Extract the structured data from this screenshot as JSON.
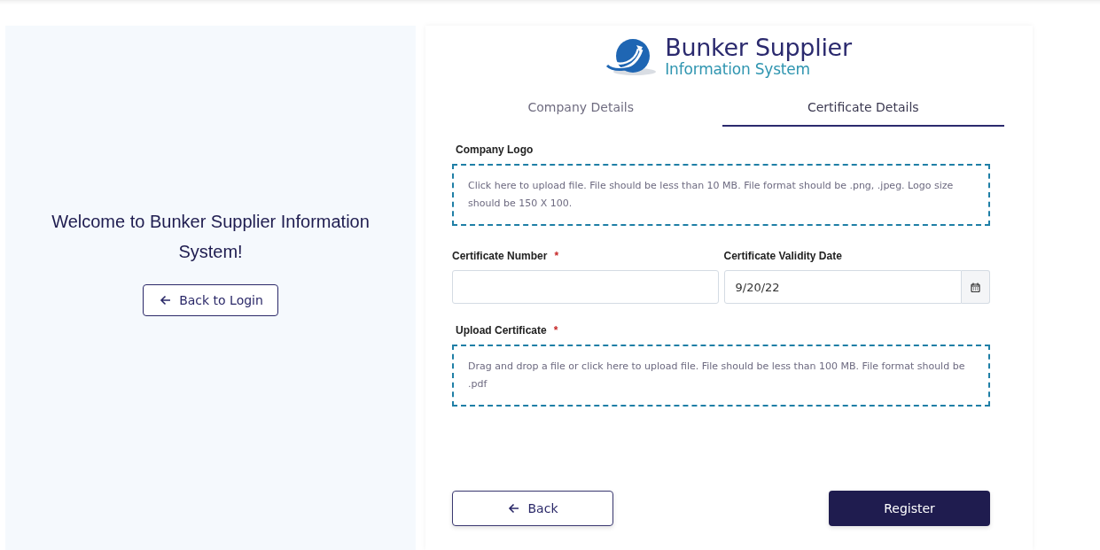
{
  "welcome": {
    "heading": "Welcome to Bunker Supplier Information System!",
    "back_button": "Back to Login"
  },
  "logo": {
    "title": "Bunker Supplier",
    "subtitle": "Information System"
  },
  "tabs": [
    {
      "label": "Company Details",
      "selected": false
    },
    {
      "label": "Certificate Details",
      "selected": true
    }
  ],
  "company_logo": {
    "label": "Company Logo",
    "hint": "Click here to upload file. File should be less than 10 MB. File format should be .png, .jpeg. Logo size should be 150 X 100."
  },
  "certificate_number": {
    "label": "Certificate Number",
    "required_mark": "*"
  },
  "validity_date": {
    "label": "Certificate Validity Date",
    "value": "9/20/22"
  },
  "upload_certificate": {
    "label": "Upload Certificate",
    "required_mark": "*",
    "hint": "Drag and drop a file or click here to upload file. File should be less than 100 MB. File format should be .pdf"
  },
  "buttons": [
    {
      "kind": "back",
      "label": "Back"
    },
    {
      "kind": "primary",
      "label": "Register"
    }
  ]
}
